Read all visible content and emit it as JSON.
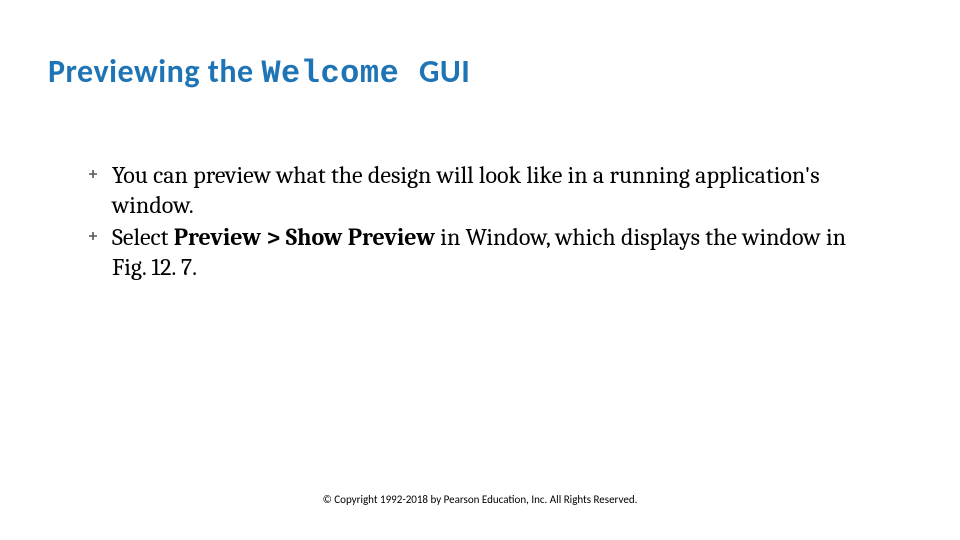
{
  "title": {
    "part1": "Previewing the ",
    "part2": "Welcome ",
    "part3": "GUI"
  },
  "bullets": [
    {
      "segments": [
        {
          "text": "You can preview what the design will look like in a running application's window.",
          "bold": false
        }
      ]
    },
    {
      "segments": [
        {
          "text": "Select ",
          "bold": false
        },
        {
          "text": "Preview > Show Preview",
          "bold": true
        },
        {
          "text": " in Window, which displays the window in Fig. 12. 7.",
          "bold": false
        }
      ]
    }
  ],
  "footer": "© Copyright 1992-2018 by Pearson Education, Inc. All Rights Reserved."
}
